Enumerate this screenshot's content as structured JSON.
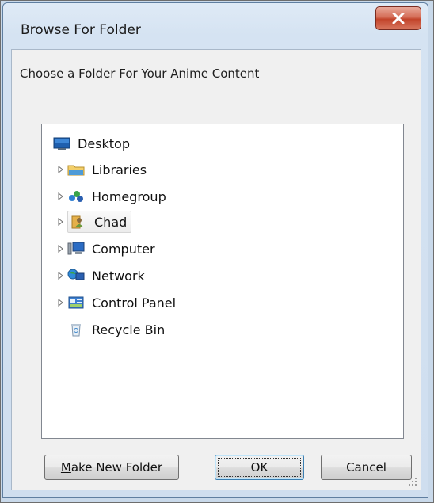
{
  "window": {
    "title": "Browse For Folder",
    "description": "Choose a Folder For Your Anime Content"
  },
  "tree": {
    "items": [
      {
        "label": "Desktop",
        "icon": "desktop-icon",
        "expandable": false
      },
      {
        "label": "Libraries",
        "icon": "libraries-icon",
        "expandable": true
      },
      {
        "label": "Homegroup",
        "icon": "homegroup-icon",
        "expandable": true
      },
      {
        "label": "Chad",
        "icon": "user-folder-icon",
        "expandable": true,
        "selected": true
      },
      {
        "label": "Computer",
        "icon": "computer-icon",
        "expandable": true
      },
      {
        "label": "Network",
        "icon": "network-icon",
        "expandable": true
      },
      {
        "label": "Control Panel",
        "icon": "control-panel-icon",
        "expandable": true
      },
      {
        "label": "Recycle Bin",
        "icon": "recycle-bin-icon",
        "expandable": false
      }
    ]
  },
  "buttons": {
    "new_folder": "Make New Folder",
    "new_folder_mnemonic": "M",
    "new_folder_rest": "ake New Folder",
    "ok": "OK",
    "cancel": "Cancel"
  },
  "colors": {
    "close_button": "#c2432a",
    "selection": "#ececec",
    "default_button_border": "#3c7fb1"
  }
}
